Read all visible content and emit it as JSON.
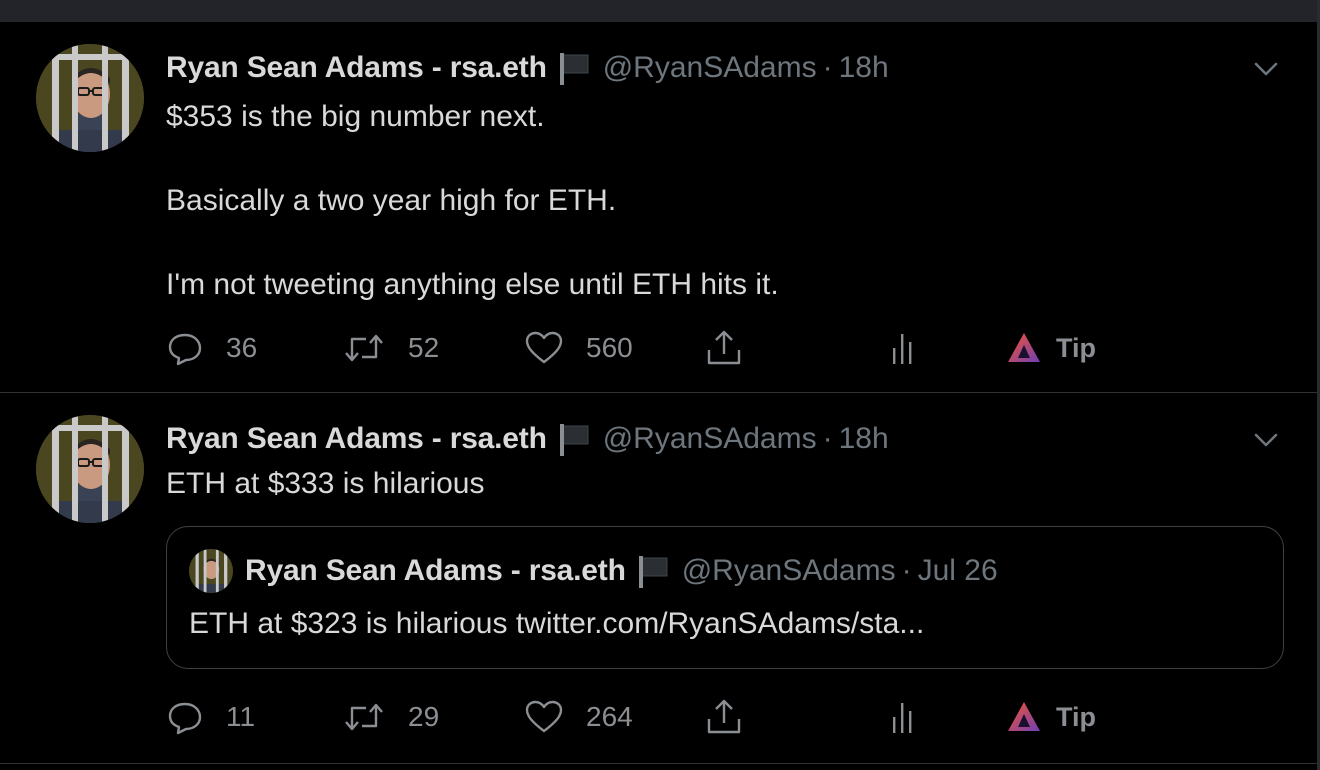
{
  "colors": {
    "background": "#000000",
    "text": "#d9d9d9",
    "secondary": "#6e767d",
    "border": "#2f3336",
    "brave_orange": "#fb542b",
    "brave_purple": "#5c3c9b"
  },
  "tweets": [
    {
      "author": {
        "name": "Ryan Sean Adams - rsa.eth",
        "flag_icon": "black-flag-icon",
        "handle": "@RyanSAdams",
        "separator": "·",
        "time": "18h"
      },
      "text_lines": [
        "$353 is the big number next.",
        "Basically a two year high for ETH.",
        "I'm not tweeting anything else until ETH hits it."
      ],
      "actions": {
        "reply_count": "36",
        "retweet_count": "52",
        "like_count": "560",
        "tip_label": "Tip"
      }
    },
    {
      "author": {
        "name": "Ryan Sean Adams - rsa.eth",
        "flag_icon": "black-flag-icon",
        "handle": "@RyanSAdams",
        "separator": "·",
        "time": "18h"
      },
      "text": "ETH at $333 is hilarious",
      "quoted": {
        "name": "Ryan Sean Adams - rsa.eth",
        "handle": "@RyanSAdams",
        "separator": "·",
        "time": "Jul 26",
        "text": "ETH at $323 is hilarious twitter.com/RyanSAdams/sta..."
      },
      "actions": {
        "reply_count": "11",
        "retweet_count": "29",
        "like_count": "264",
        "tip_label": "Tip"
      }
    }
  ]
}
